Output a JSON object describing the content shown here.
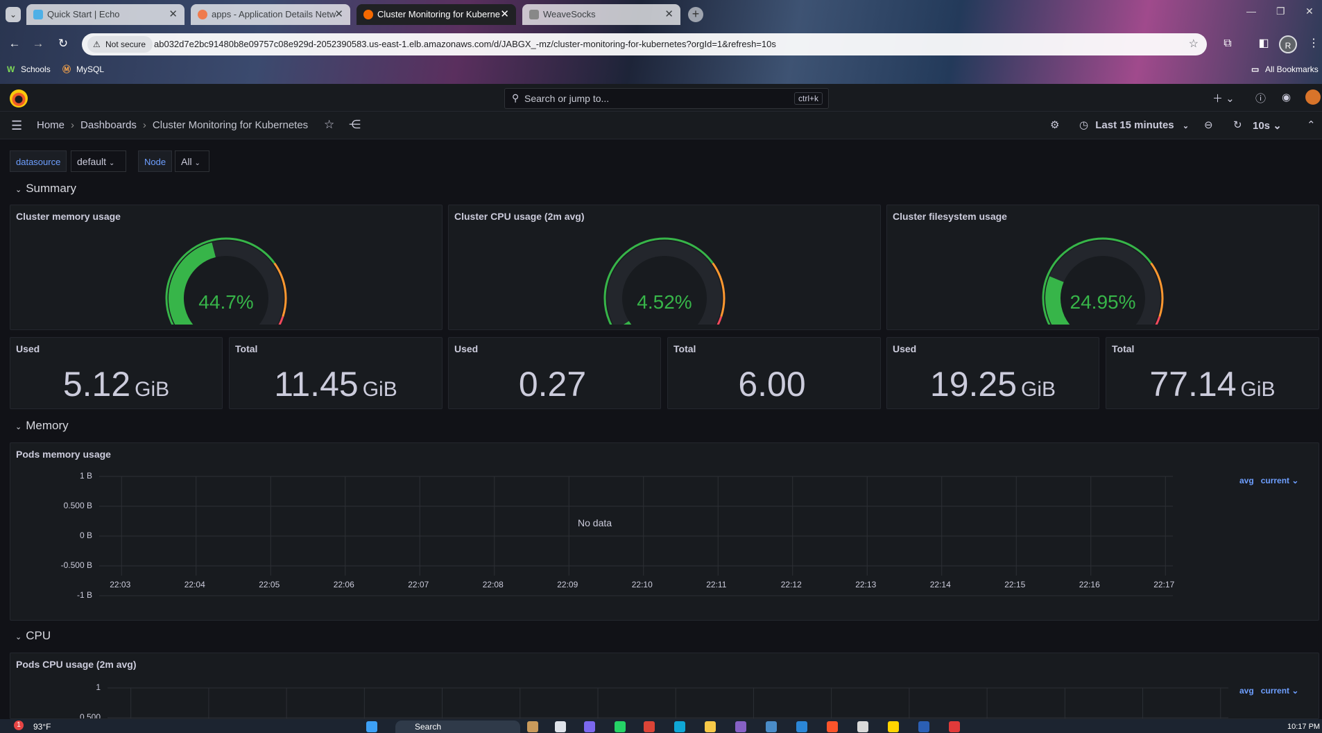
{
  "browser": {
    "tabs": [
      {
        "title": "Quick Start | Echo",
        "active": false
      },
      {
        "title": "apps - Application Details Netw",
        "active": false
      },
      {
        "title": "Cluster Monitoring for Kuberne",
        "active": true
      },
      {
        "title": "WeaveSocks",
        "active": false
      }
    ],
    "not_secure_label": "Not secure",
    "url": "ab032d7e2bc91480b8e09757c08e929d-2052390583.us-east-1.elb.amazonaws.com/d/JABGX_-mz/cluster-monitoring-for-kubernetes?orgId=1&refresh=10s",
    "profile_initial": "R",
    "bookmarks": [
      {
        "label": "Schools",
        "icon": "w-icon"
      },
      {
        "label": "MySQL",
        "icon": "mysql-icon"
      }
    ],
    "all_bookmarks_label": "All Bookmarks"
  },
  "grafana": {
    "search_placeholder": "Search or jump to...",
    "search_shortcut": "ctrl+k",
    "breadcrumbs": [
      "Home",
      "Dashboards",
      "Cluster Monitoring for Kubernetes"
    ],
    "time_range": "Last 15 minutes",
    "refresh_interval": "10s",
    "variables": [
      {
        "label": "datasource",
        "value": "default"
      },
      {
        "label": "Node",
        "value": "All"
      }
    ],
    "rows": {
      "summary": "Summary",
      "memory": "Memory",
      "cpu": "CPU"
    },
    "gauges": [
      {
        "title": "Cluster memory usage",
        "value": "44.7%",
        "fraction": 0.447
      },
      {
        "title": "Cluster CPU usage (2m avg)",
        "value": "4.52%",
        "fraction": 0.0452
      },
      {
        "title": "Cluster filesystem usage",
        "value": "24.95%",
        "fraction": 0.2495
      }
    ],
    "stats": [
      {
        "title": "Used",
        "value": "5.12",
        "unit": "GiB"
      },
      {
        "title": "Total",
        "value": "11.45",
        "unit": "GiB"
      },
      {
        "title": "Used",
        "value": "0.27",
        "unit": ""
      },
      {
        "title": "Total",
        "value": "6.00",
        "unit": ""
      },
      {
        "title": "Used",
        "value": "19.25",
        "unit": "GiB"
      },
      {
        "title": "Total",
        "value": "77.14",
        "unit": "GiB"
      }
    ],
    "colors": {
      "green": "#37b549",
      "orange": "#ff9830",
      "red": "#f2495c",
      "link": "#6e9fff"
    }
  },
  "chart_data": [
    {
      "type": "line",
      "title": "Pods memory usage",
      "y_ticks": [
        "1 B",
        "0.500 B",
        "0 B",
        "-0.500 B",
        "-1 B"
      ],
      "ylim": [
        -1,
        1
      ],
      "x_ticks": [
        "22:03",
        "22:04",
        "22:05",
        "22:06",
        "22:07",
        "22:08",
        "22:09",
        "22:10",
        "22:11",
        "22:12",
        "22:13",
        "22:14",
        "22:15",
        "22:16",
        "22:17"
      ],
      "series": [],
      "no_data_label": "No data",
      "legend_controls": [
        "avg",
        "current"
      ],
      "grid": true
    },
    {
      "type": "line",
      "title": "Pods CPU usage (2m avg)",
      "y_ticks": [
        "1",
        "0.500"
      ],
      "series": [],
      "legend_controls": [
        "avg",
        "current"
      ],
      "grid": true
    }
  ],
  "taskbar": {
    "weather": "93°F",
    "weather_badge": "1",
    "search_label": "Search",
    "clock": "10:17 PM"
  }
}
